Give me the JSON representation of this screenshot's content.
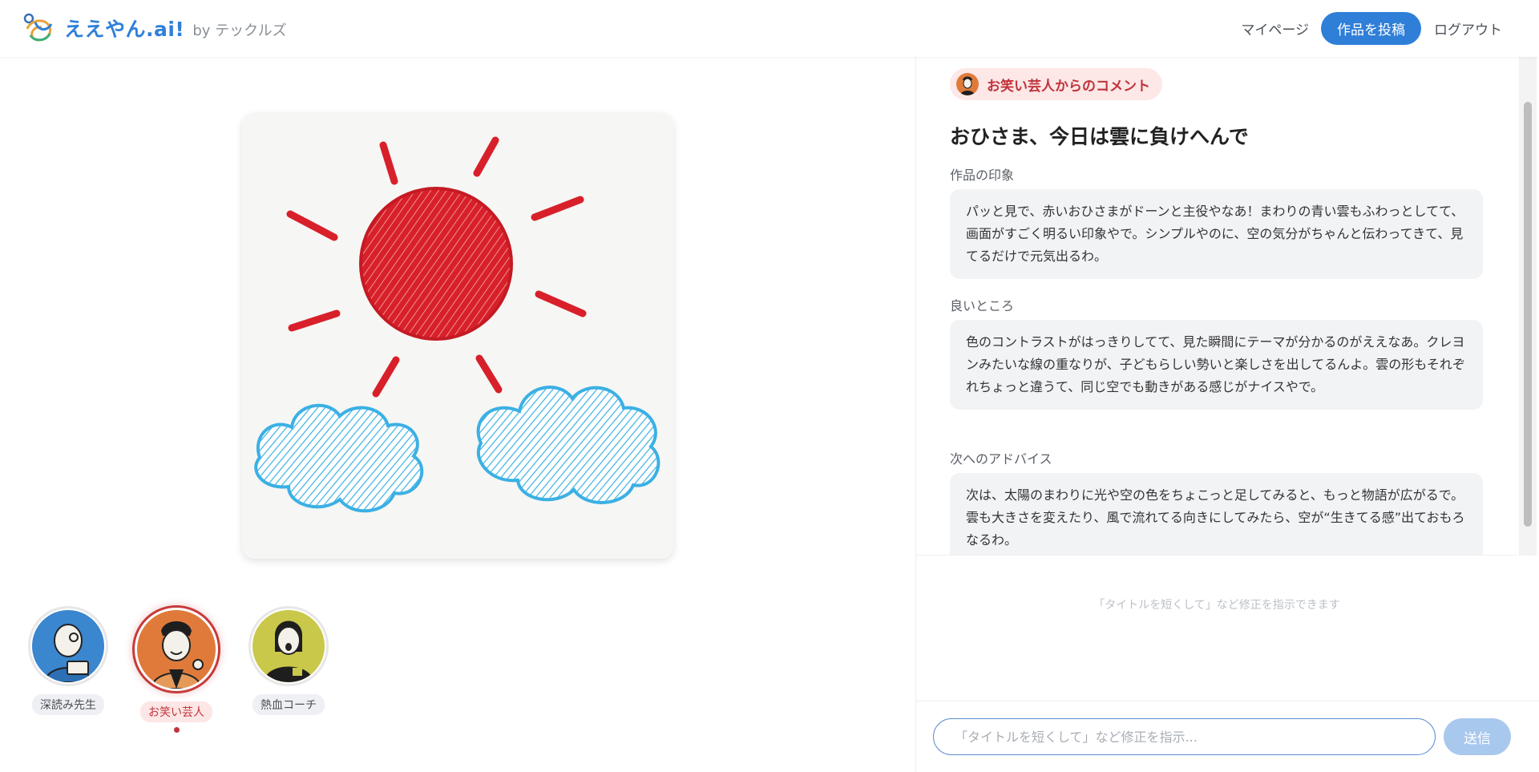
{
  "brand": {
    "name": "ええやん.ai!",
    "byline": "by テックルズ"
  },
  "nav": {
    "mypage": "マイページ",
    "post": "作品を投稿",
    "logout": "ログアウト"
  },
  "commentators": [
    {
      "name": "深読み先生",
      "active": false,
      "color": "#3a86cf"
    },
    {
      "name": "お笑い芸人",
      "active": true,
      "color": "#e07a3a"
    },
    {
      "name": "熱血コーチ",
      "active": false,
      "color": "#c9c84a"
    }
  ],
  "comment": {
    "badge": "お笑い芸人からのコメント",
    "title": "おひさま、今日は雲に負けへんで",
    "sections": [
      {
        "label": "作品の印象",
        "body": "パッと見で、赤いおひさまがドーンと主役やなあ！まわりの青い雲もふわっとしてて、画面がすごく明るい印象やで。シンプルやのに、空の気分がちゃんと伝わってきて、見てるだけで元気出るわ。"
      },
      {
        "label": "良いところ",
        "body": "色のコントラストがはっきりしてて、見た瞬間にテーマが分かるのがええなあ。クレヨンみたいな線の重なりが、子どもらしい勢いと楽しさを出してるんよ。雲の形もそれぞれちょっと違うて、同じ空でも動きがある感じがナイスやで。"
      },
      {
        "label": "次へのアドバイス",
        "body": "次は、太陽のまわりに光や空の色をちょこっと足してみると、もっと物語が広がるで。雲も大きさを変えたり、風で流れてる向きにしてみたら、空が“生きてる感”出ておもろなるわ。"
      }
    ]
  },
  "composer": {
    "hint": "「タイトルを短くして」など修正を指示できます",
    "placeholder": "「タイトルを短くして」など修正を指示...",
    "send": "送信"
  },
  "colors": {
    "accent": "#2f7fd8",
    "comedian": "#c0343a",
    "sun": "#d8202a",
    "cloud": "#3bb0e4"
  }
}
